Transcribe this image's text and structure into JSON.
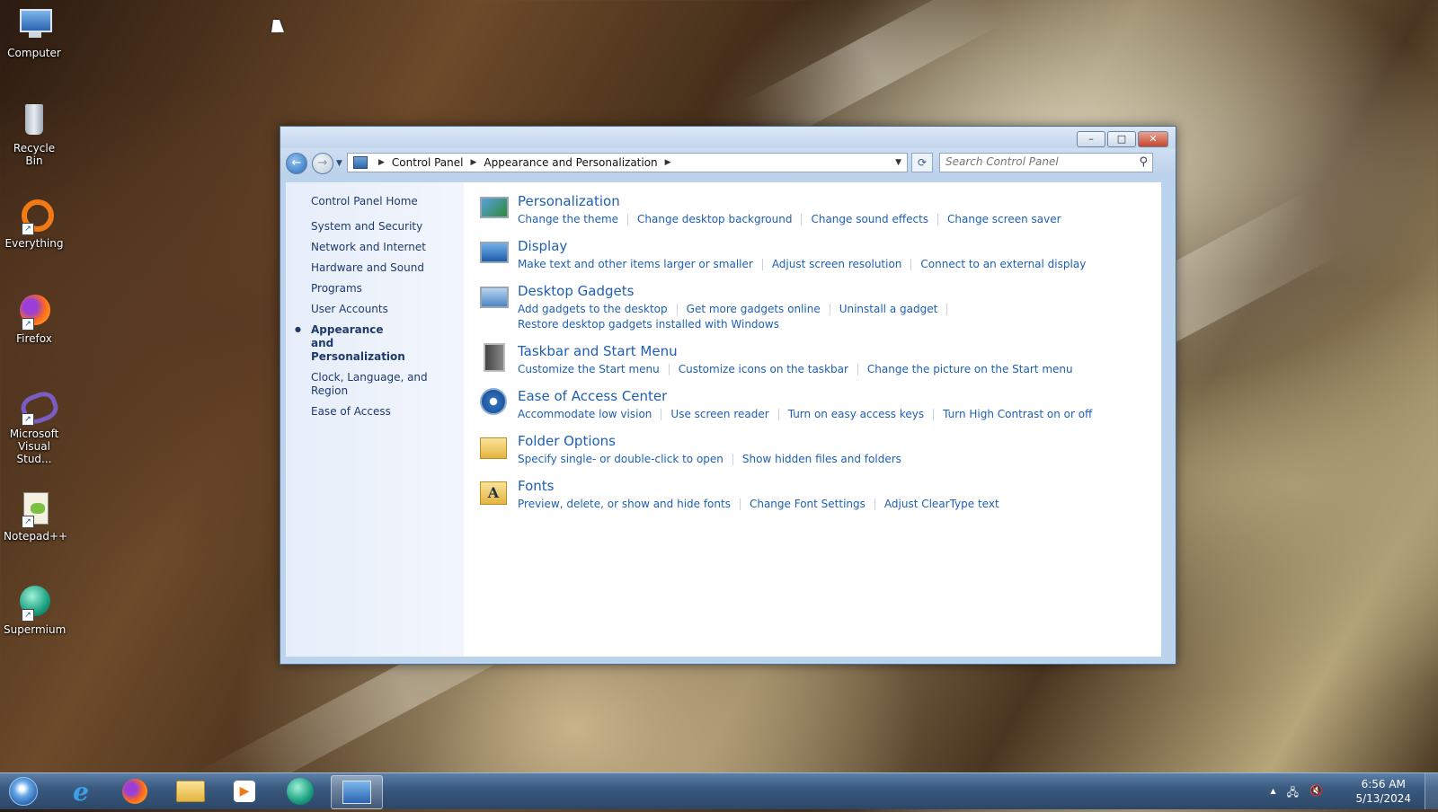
{
  "desktop": {
    "icons": [
      {
        "label": "Computer",
        "icon": "computer-icon"
      },
      {
        "label": "Recycle Bin",
        "icon": "recycle-bin-icon"
      },
      {
        "label": "Everything",
        "icon": "everything-icon"
      },
      {
        "label": "Firefox",
        "icon": "firefox-icon"
      },
      {
        "label": "Microsoft Visual Stud...",
        "icon": "visual-studio-icon"
      },
      {
        "label": "Notepad++",
        "icon": "notepadpp-icon"
      },
      {
        "label": "Supermium",
        "icon": "supermium-icon"
      }
    ]
  },
  "window": {
    "buttons": {
      "minimize": "–",
      "maximize": "□",
      "close": "✕"
    },
    "breadcrumb": [
      "Control Panel",
      "Appearance and Personalization"
    ],
    "search_placeholder": "Search Control Panel"
  },
  "sidebar": {
    "home": "Control Panel Home",
    "items": [
      {
        "label": "System and Security",
        "current": false
      },
      {
        "label": "Network and Internet",
        "current": false
      },
      {
        "label": "Hardware and Sound",
        "current": false
      },
      {
        "label": "Programs",
        "current": false
      },
      {
        "label": "User Accounts",
        "current": false
      },
      {
        "label": "Appearance and Personalization",
        "current": true
      },
      {
        "label": "Clock, Language, and Region",
        "current": false
      },
      {
        "label": "Ease of Access",
        "current": false
      }
    ]
  },
  "categories": [
    {
      "title": "Personalization",
      "icon": "personalization-icon",
      "links": [
        "Change the theme",
        "Change desktop background",
        "Change sound effects",
        "Change screen saver"
      ]
    },
    {
      "title": "Display",
      "icon": "display-icon",
      "links": [
        "Make text and other items larger or smaller",
        "Adjust screen resolution",
        "Connect to an external display"
      ]
    },
    {
      "title": "Desktop Gadgets",
      "icon": "gadgets-icon",
      "links": [
        "Add gadgets to the desktop",
        "Get more gadgets online",
        "Uninstall a gadget"
      ],
      "links2": [
        "Restore desktop gadgets installed with Windows"
      ]
    },
    {
      "title": "Taskbar and Start Menu",
      "icon": "taskbar-icon",
      "links": [
        "Customize the Start menu",
        "Customize icons on the taskbar",
        "Change the picture on the Start menu"
      ]
    },
    {
      "title": "Ease of Access Center",
      "icon": "ease-of-access-icon",
      "links": [
        "Accommodate low vision",
        "Use screen reader",
        "Turn on easy access keys",
        "Turn High Contrast on or off"
      ]
    },
    {
      "title": "Folder Options",
      "icon": "folder-options-icon",
      "links": [
        "Specify single- or double-click to open",
        "Show hidden files and folders"
      ]
    },
    {
      "title": "Fonts",
      "icon": "fonts-icon",
      "links": [
        "Preview, delete, or show and hide fonts",
        "Change Font Settings",
        "Adjust ClearType text"
      ]
    }
  ],
  "taskbar": {
    "clock_time": "6:56 AM",
    "clock_date": "5/13/2024",
    "tray_arrow": "▲"
  }
}
